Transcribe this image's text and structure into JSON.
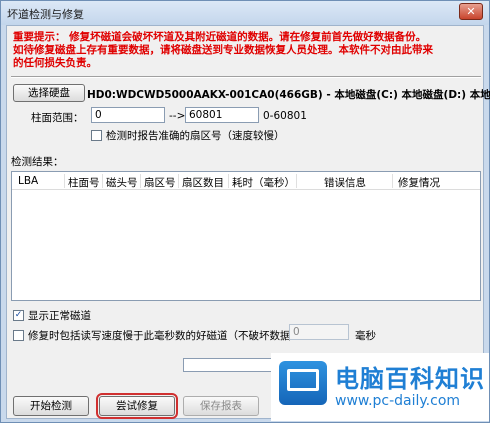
{
  "window": {
    "title": "坏道检测与修复",
    "close_glyph": "✕"
  },
  "warning": {
    "line1": "重要提示： 修复坏磁道会破坏坏道及其附近磁道的数据。请在修复前首先做好数据备份。",
    "line2": "如待修复磁盘上存有重要数据，请将磁盘送到专业数据恢复人员处理。本软件不对由此带来",
    "line3": "的任何损失负责。"
  },
  "disk": {
    "select_button": "选择硬盘",
    "info": "HD0:WDCWD5000AAKX-001CA0(466GB) - 本地磁盘(C:) 本地磁盘(D:) 本地磁盘"
  },
  "range": {
    "label": "柱面范围：",
    "start_value": "0",
    "arrow": "-->",
    "end_value": "60801",
    "hint": "0-60801"
  },
  "options": {
    "report_accurate_sector": "检测时报告准确的扇区号（速度较慢）",
    "show_normal_tracks": "显示正常磁道",
    "include_slow_tracks": "修复时包括读写速度慢于此毫秒数的好磁道（不破坏数据）：",
    "ms_value": "0",
    "ms_unit": "毫秒"
  },
  "results": {
    "label": "检测结果：",
    "columns": [
      "LBA",
      "柱面号",
      "磁头号",
      "扇区号",
      "扇区数目",
      "耗时（毫秒）",
      "错误信息",
      "修复情况"
    ]
  },
  "progress": {
    "value": 0
  },
  "buttons": {
    "start_detect": "开始检测",
    "try_repair": "尝试修复",
    "save_report": "保存报表"
  },
  "watermark": {
    "title": "电脑百科知识",
    "url": "www.pc-daily.com"
  },
  "colors": {
    "warning": "#e00000",
    "brand": "#1f7fd4"
  }
}
